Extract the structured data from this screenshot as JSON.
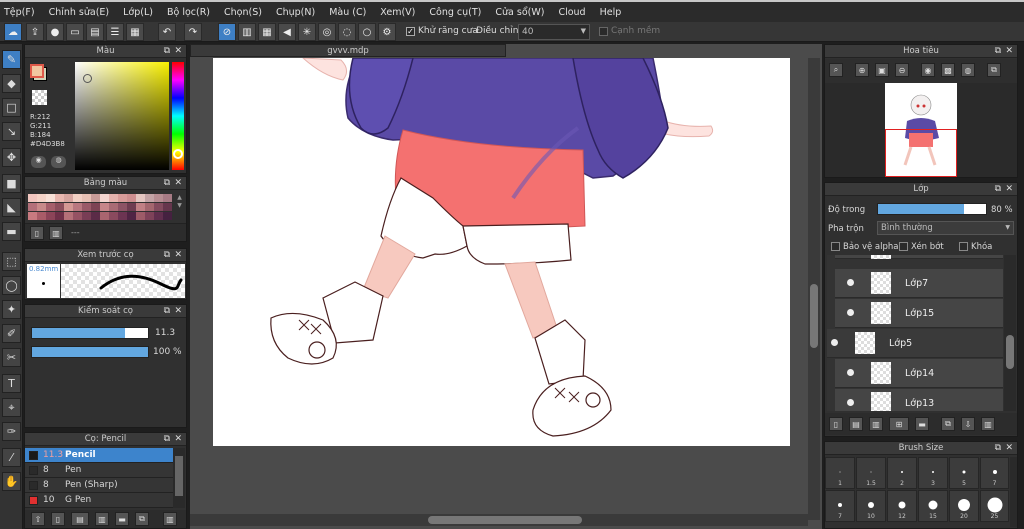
{
  "menu": [
    "Tệp(F)",
    "Chỉnh sửa(E)",
    "Lớp(L)",
    "Bộ lọc(R)",
    "Chọn(S)",
    "Chụp(N)",
    "Màu (C)",
    "Xem(V)",
    "Công cụ(T)",
    "Cửa sổ(W)",
    "Cloud",
    "Help"
  ],
  "toolbar": {
    "antialias_label": "Khử răng cưa",
    "antialias_checked": true,
    "smoothing_label": "Điều chỉnh",
    "smoothing_value": "40",
    "soft_edge_label": "Cạnh mềm"
  },
  "color_panel": {
    "title": "Màu",
    "rgb": [
      "R:212",
      "G:211",
      "B:184",
      "#D4D3B8"
    ],
    "foreground": "#D4D3B8",
    "accent_fg": "#e05a4a"
  },
  "palette_panel": {
    "title": "Bảng màu",
    "note": "---"
  },
  "preview_panel": {
    "title": "Xem trước cọ",
    "size": "0.82mm"
  },
  "brush_control": {
    "title": "Kiểm soát cọ",
    "size_value": "11.3",
    "opacity_value": "100 %",
    "size_fraction": 0.8,
    "opacity_fraction": 1.0
  },
  "brush_panel": {
    "title": "Cọ: Pencil",
    "items": [
      {
        "size": "11.3",
        "name": "Pencil",
        "color": "#1a1a1a",
        "selected": true
      },
      {
        "size": "8",
        "name": "Pen",
        "color": "#2a2a2a",
        "selected": false
      },
      {
        "size": "8",
        "name": "Pen (Sharp)",
        "color": "#2a2a2a",
        "selected": false
      },
      {
        "size": "10",
        "name": "G Pen",
        "color": "#e03030",
        "selected": false
      }
    ]
  },
  "document": {
    "tab_title": "gvvv.mdp"
  },
  "navigator": {
    "title": "Hoa tiêu"
  },
  "layer_panel": {
    "title": "Lớp",
    "opacity_label": "Độ trong",
    "opacity_value": "80 %",
    "opacity_fraction": 0.8,
    "blend_label": "Pha trộn",
    "blend_value": "Bình thường",
    "protect_alpha": "Bảo vệ alpha",
    "clipping": "Xén bớt",
    "lock": "Khóa",
    "layers": [
      {
        "name": "Lớp7",
        "selected": false
      },
      {
        "name": "Lớp15",
        "selected": false
      },
      {
        "name": "Lớp5",
        "selected": true
      },
      {
        "name": "Lớp14",
        "selected": false
      },
      {
        "name": "Lớp13",
        "selected": false
      }
    ]
  },
  "brush_size": {
    "title": "Brush Size",
    "row1": [
      "1",
      "1.5",
      "2",
      "3",
      "5",
      "7"
    ],
    "row2": [
      "7",
      "10",
      "12",
      "15",
      "20",
      "25"
    ]
  }
}
